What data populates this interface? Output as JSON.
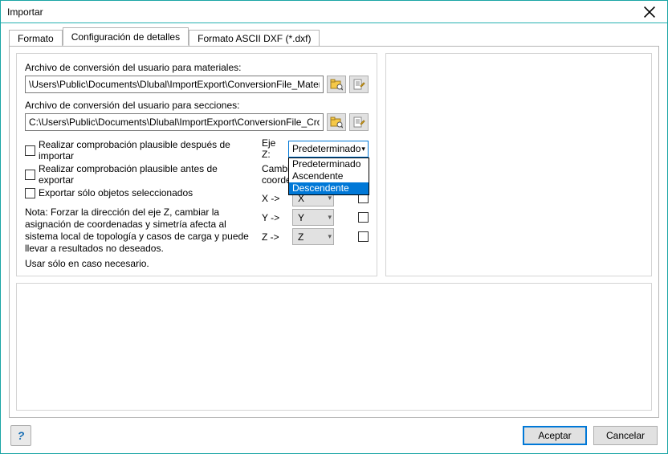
{
  "window": {
    "title": "Importar"
  },
  "tabs": {
    "items": [
      {
        "label": "Formato"
      },
      {
        "label": "Configuración de detalles"
      },
      {
        "label": "Formato ASCII DXF (*.dxf)"
      }
    ],
    "active_index": 1
  },
  "panel": {
    "materials_label": "Archivo de conversión del usuario para materiales:",
    "materials_path": "\\Users\\Public\\Documents\\Dlubal\\ImportExport\\ConversionFile_Material.txt",
    "sections_label": "Archivo de conversión del usuario para secciones:",
    "sections_path": "C:\\Users\\Public\\Documents\\Dlubal\\ImportExport\\ConversionFile_CrossSect",
    "check_after": "Realizar comprobación plausible después de importar",
    "check_before": "Realizar comprobación plausible antes de exportar",
    "export_selected": "Exportar sólo objetos seleccionados",
    "note": "Nota: Forzar la dirección del eje Z, cambiar la asignación de coordenadas y simetría afecta al sistema local de topología y casos de carga y puede llevar a resultados no deseados.",
    "note2": "Usar sólo en caso necesario.",
    "ejez_label": "Eje Z:",
    "ejez_value": "Predeterminado",
    "ejez_opts": [
      "Predeterminado",
      "Ascendente",
      "Descendente"
    ],
    "cambia_line1": "Cambia",
    "cambia_line2": "coorde",
    "rows": [
      {
        "lbl": "X ->",
        "val": "X"
      },
      {
        "lbl": "Y ->",
        "val": "Y"
      },
      {
        "lbl": "Z ->",
        "val": "Z"
      }
    ]
  },
  "footer": {
    "ok": "Aceptar",
    "cancel": "Cancelar"
  },
  "icons": {
    "browse": "browse-icon",
    "edit": "edit-icon"
  }
}
